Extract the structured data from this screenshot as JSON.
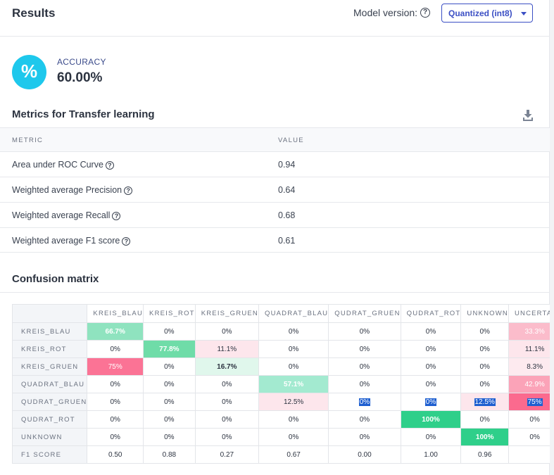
{
  "header": {
    "title": "Results",
    "model_version_label": "Model version:",
    "model_version_value": "Quantized (int8)"
  },
  "accuracy": {
    "icon": "percent-icon",
    "label": "ACCURACY",
    "value": "60.00%"
  },
  "metrics": {
    "title": "Metrics for Transfer learning",
    "col_metric": "METRIC",
    "col_value": "VALUE",
    "rows": [
      {
        "label": "Area under ROC Curve",
        "value": "0.94"
      },
      {
        "label": "Weighted average Precision",
        "value": "0.64"
      },
      {
        "label": "Weighted average Recall",
        "value": "0.68"
      },
      {
        "label": "Weighted average F1 score",
        "value": "0.61"
      }
    ]
  },
  "confusion": {
    "title": "Confusion matrix",
    "columns": [
      "KREIS_BLAU",
      "KREIS_ROT",
      "KREIS_GRUEN",
      "QUADRAT_BLAU",
      "QUDRAT_GRUEN",
      "QUDRAT_ROT",
      "UNKNOWN",
      "UNCERTAIN"
    ],
    "rows": [
      {
        "label": "KREIS_BLAU",
        "cells": [
          "66.7%",
          "0%",
          "0%",
          "0%",
          "0%",
          "0%",
          "0%",
          "33.3%"
        ]
      },
      {
        "label": "KREIS_ROT",
        "cells": [
          "0%",
          "77.8%",
          "11.1%",
          "0%",
          "0%",
          "0%",
          "0%",
          "11.1%"
        ]
      },
      {
        "label": "KREIS_GRUEN",
        "cells": [
          "75%",
          "0%",
          "16.7%",
          "0%",
          "0%",
          "0%",
          "0%",
          "8.3%"
        ]
      },
      {
        "label": "QUADRAT_BLAU",
        "cells": [
          "0%",
          "0%",
          "0%",
          "57.1%",
          "0%",
          "0%",
          "0%",
          "42.9%"
        ]
      },
      {
        "label": "QUDRAT_GRUEN",
        "cells": [
          "0%",
          "0%",
          "0%",
          "12.5%",
          "0%",
          "0%",
          "12.5%",
          "75%"
        ]
      },
      {
        "label": "QUDRAT_ROT",
        "cells": [
          "0%",
          "0%",
          "0%",
          "0%",
          "0%",
          "100%",
          "0%",
          "0%"
        ]
      },
      {
        "label": "UNKNOWN",
        "cells": [
          "0%",
          "0%",
          "0%",
          "0%",
          "0%",
          "0%",
          "100%",
          "0%"
        ]
      }
    ],
    "f1_label": "F1 SCORE",
    "f1": [
      "0.50",
      "0.88",
      "0.27",
      "0.67",
      "0.00",
      "1.00",
      "0.96",
      ""
    ],
    "cell_styles": [
      [
        {
          "bg": "#8fe3bf",
          "bold": true,
          "text": "#ffffff"
        },
        {},
        {},
        {},
        {},
        {},
        {},
        {
          "bg": "#fbbccb",
          "text": "#ffffff"
        }
      ],
      [
        {},
        {
          "bg": "#6fdca8",
          "bold": true,
          "text": "#ffffff"
        },
        {
          "bg": "#fde6ec"
        },
        {},
        {},
        {},
        {},
        {
          "bg": "#fde6ec"
        }
      ],
      [
        {
          "bg": "#fb7395",
          "text": "#ffffff"
        },
        {},
        {
          "bg": "#e0f7ec",
          "bold": true,
          "dark": true
        },
        {},
        {},
        {},
        {},
        {
          "bg": "#fdeaef"
        }
      ],
      [
        {},
        {},
        {},
        {
          "bg": "#a3ead0",
          "bold": true,
          "text": "#ffffff"
        },
        {},
        {},
        {},
        {
          "bg": "#fba3b8",
          "text": "#ffffff"
        }
      ],
      [
        {},
        {},
        {},
        {
          "bg": "#fde6ec"
        },
        {
          "sel": true
        },
        {
          "sel": true
        },
        {
          "bg": "#fde6ec",
          "sel": true
        },
        {
          "bg": "#fb6a8e",
          "sel": true
        }
      ],
      [
        {},
        {},
        {},
        {},
        {},
        {
          "bg": "#2fcf8a",
          "bold": true,
          "text": "#ffffff"
        },
        {},
        {}
      ],
      [
        {},
        {},
        {},
        {},
        {},
        {},
        {
          "bg": "#2fcf8a",
          "bold": true,
          "text": "#ffffff"
        },
        {}
      ]
    ]
  }
}
